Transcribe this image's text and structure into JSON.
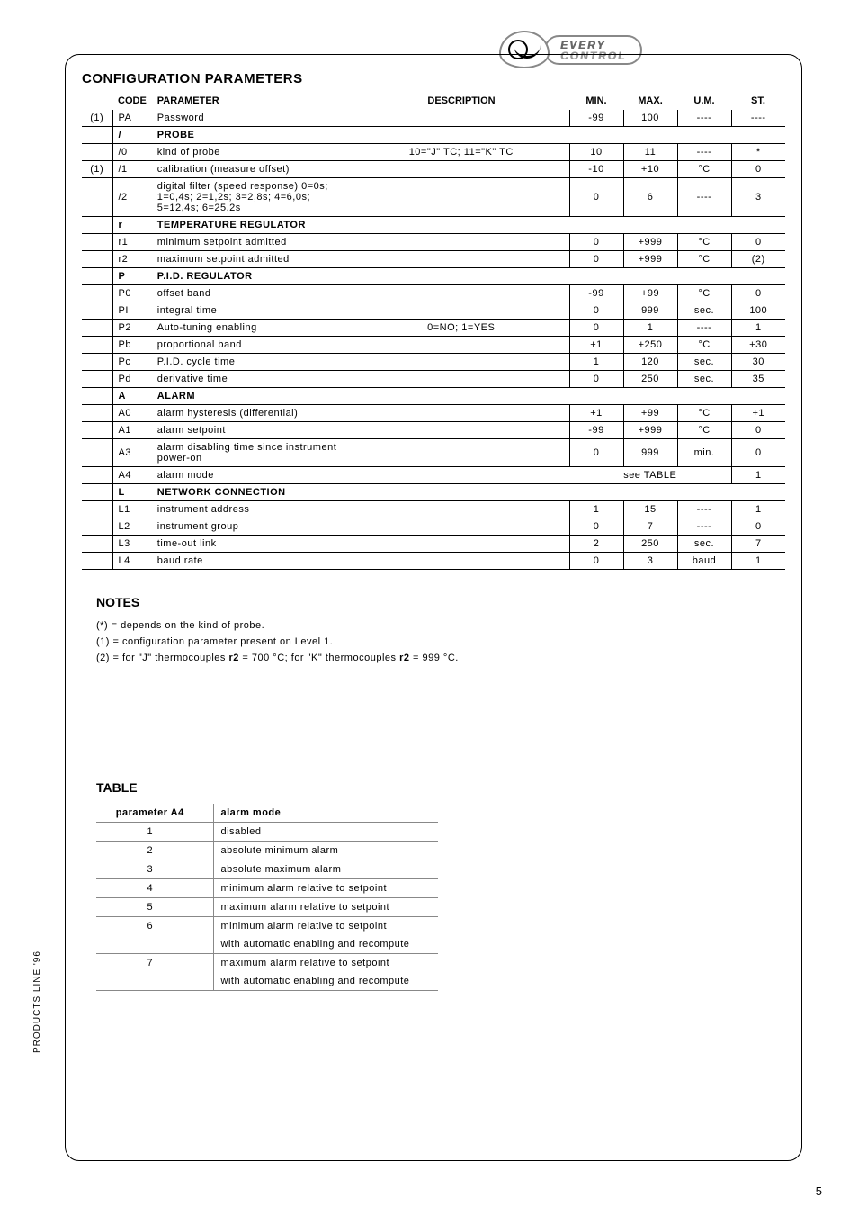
{
  "logo": {
    "line1": "EVERY",
    "line2": "CONTROL"
  },
  "section_title": "CONFIGURATION PARAMETERS",
  "headers": {
    "code": "CODE",
    "parameter": "PARAMETER",
    "description": "DESCRIPTION",
    "min": "MIN.",
    "max": "MAX.",
    "um": "U.M.",
    "st": "ST."
  },
  "rows": [
    {
      "flag": "(1)",
      "code": "PA",
      "param": "Password",
      "desc": "",
      "min": "-99",
      "max": "100",
      "um": "----",
      "st": "----"
    },
    {
      "section": true,
      "code": "/",
      "param": "PROBE"
    },
    {
      "flag": "",
      "code": "/0",
      "param": "kind of probe",
      "desc": "10=\"J\" TC; 11=\"K\" TC",
      "min": "10",
      "max": "11",
      "um": "----",
      "st": "*"
    },
    {
      "flag": "(1)",
      "code": "/1",
      "param": "calibration (measure offset)",
      "desc": "",
      "min": "-10",
      "max": "+10",
      "um": "°C",
      "st": "0"
    },
    {
      "flag": "",
      "code": "/2",
      "param": "digital filter (speed response) 0=0s; 1=0,4s; 2=1,2s; 3=2,8s; 4=6,0s; 5=12,4s; 6=25,2s",
      "desc": "",
      "min": "0",
      "max": "6",
      "um": "----",
      "st": "3"
    },
    {
      "section": true,
      "code": "r",
      "param": "TEMPERATURE REGULATOR"
    },
    {
      "flag": "",
      "code": "r1",
      "param": "minimum setpoint admitted",
      "desc": "",
      "min": "0",
      "max": "+999",
      "um": "°C",
      "st": "0"
    },
    {
      "flag": "",
      "code": "r2",
      "param": "maximum setpoint admitted",
      "desc": "",
      "min": "0",
      "max": "+999",
      "um": "°C",
      "st": "(2)"
    },
    {
      "section": true,
      "code": "P",
      "param": "P.I.D. REGULATOR"
    },
    {
      "flag": "",
      "code": "P0",
      "param": "offset band",
      "desc": "",
      "min": "-99",
      "max": "+99",
      "um": "°C",
      "st": "0"
    },
    {
      "flag": "",
      "code": "PI",
      "param": "integral time",
      "desc": "",
      "min": "0",
      "max": "999",
      "um": "sec.",
      "st": "100"
    },
    {
      "flag": "",
      "code": "P2",
      "param": "Auto-tuning enabling",
      "desc": "0=NO; 1=YES",
      "min": "0",
      "max": "1",
      "um": "----",
      "st": "1"
    },
    {
      "flag": "",
      "code": "Pb",
      "param": "proportional band",
      "desc": "",
      "min": "+1",
      "max": "+250",
      "um": "°C",
      "st": "+30"
    },
    {
      "flag": "",
      "code": "Pc",
      "param": "P.I.D. cycle time",
      "desc": "",
      "min": "1",
      "max": "120",
      "um": "sec.",
      "st": "30"
    },
    {
      "flag": "",
      "code": "Pd",
      "param": "derivative time",
      "desc": "",
      "min": "0",
      "max": "250",
      "um": "sec.",
      "st": "35"
    },
    {
      "section": true,
      "code": "A",
      "param": "ALARM"
    },
    {
      "flag": "",
      "code": "A0",
      "param": "alarm hysteresis (differential)",
      "desc": "",
      "min": "+1",
      "max": "+99",
      "um": "°C",
      "st": "+1"
    },
    {
      "flag": "",
      "code": "A1",
      "param": "alarm setpoint",
      "desc": "",
      "min": "-99",
      "max": "+999",
      "um": "°C",
      "st": "0"
    },
    {
      "flag": "",
      "code": "A3",
      "param": "alarm disabling time since instrument power-on",
      "desc": "",
      "min": "0",
      "max": "999",
      "um": "min.",
      "st": "0"
    },
    {
      "flag": "",
      "code": "A4",
      "param": "alarm mode",
      "desc": "",
      "seetable": "see TABLE",
      "st": "1"
    },
    {
      "section": true,
      "code": "L",
      "param": "NETWORK CONNECTION"
    },
    {
      "flag": "",
      "code": "L1",
      "param": "instrument address",
      "desc": "",
      "min": "1",
      "max": "15",
      "um": "----",
      "st": "1"
    },
    {
      "flag": "",
      "code": "L2",
      "param": "instrument group",
      "desc": "",
      "min": "0",
      "max": "7",
      "um": "----",
      "st": "0"
    },
    {
      "flag": "",
      "code": "L3",
      "param": "time-out link",
      "desc": "",
      "min": "2",
      "max": "250",
      "um": "sec.",
      "st": "7"
    },
    {
      "flag": "",
      "code": "L4",
      "param": "baud rate",
      "desc": "",
      "min": "0",
      "max": "3",
      "um": "baud",
      "st": "1"
    }
  ],
  "notes": {
    "title": "NOTES",
    "items": [
      "(*) = depends on the kind of probe.",
      "(1) = configuration parameter present on Level 1.",
      "(2) = for \"J\" thermocouples r2 = 700 °C; for \"K\" thermocouples r2 = 999 °C."
    ]
  },
  "table": {
    "title": "TABLE",
    "head": {
      "c1": "parameter A4",
      "c2": "alarm mode"
    },
    "rows": [
      {
        "v": "1",
        "d": "disabled"
      },
      {
        "v": "2",
        "d": "absolute minimum alarm"
      },
      {
        "v": "3",
        "d": "absolute maximum alarm"
      },
      {
        "v": "4",
        "d": "minimum alarm relative to setpoint"
      },
      {
        "v": "5",
        "d": "maximum alarm relative to setpoint"
      },
      {
        "v": "6",
        "d": "minimum alarm relative to setpoint\nwith automatic enabling and recompute"
      },
      {
        "v": "7",
        "d": "maximum alarm relative to setpoint\nwith automatic enabling and recompute"
      }
    ]
  },
  "side_label": "PRODUCTS LINE '96",
  "page_num": "5"
}
